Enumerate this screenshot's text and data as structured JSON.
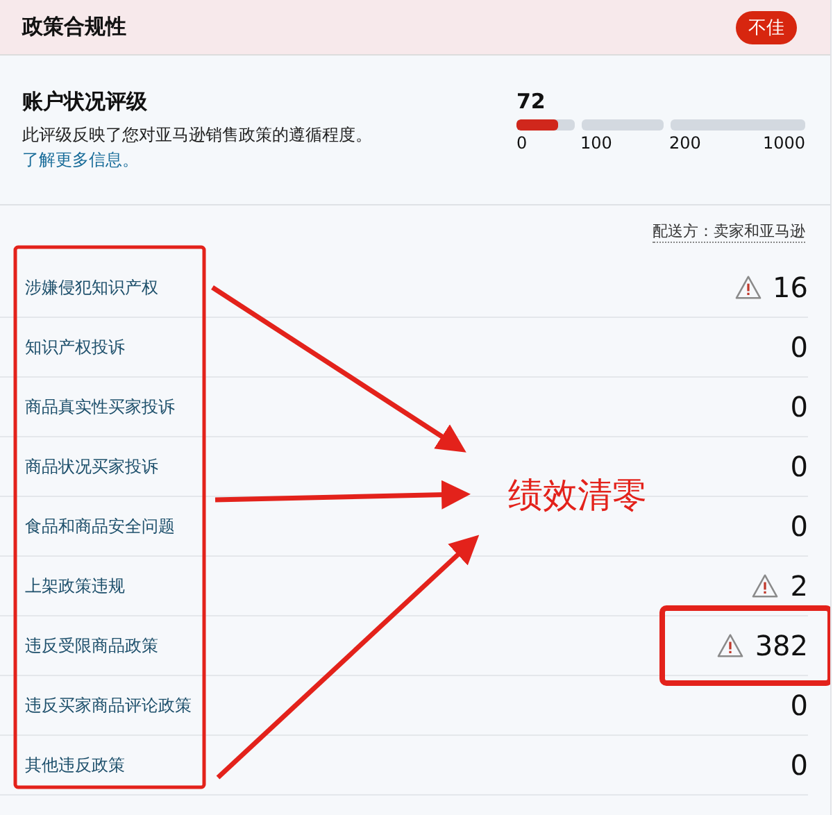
{
  "header": {
    "title": "政策合规性",
    "badge": "不佳"
  },
  "rating": {
    "title": "账户状况评级",
    "description": "此评级反映了您对亚马逊销售政策的遵循程度。",
    "link": "了解更多信息。",
    "score": "72",
    "level": 0.72,
    "ticks": [
      "0",
      "100",
      "200",
      "1000"
    ]
  },
  "fulfilled_by": "配送方：卖家和亚马逊",
  "rows": [
    {
      "label": "涉嫌侵犯知识产权",
      "value": "16",
      "warning": true
    },
    {
      "label": "知识产权投诉",
      "value": "0",
      "warning": false
    },
    {
      "label": "商品真实性买家投诉",
      "value": "0",
      "warning": false
    },
    {
      "label": "商品状况买家投诉",
      "value": "0",
      "warning": false
    },
    {
      "label": "食品和商品安全问题",
      "value": "0",
      "warning": false
    },
    {
      "label": "上架政策违规",
      "value": "2",
      "warning": true
    },
    {
      "label": "违反受限商品政策",
      "value": "382",
      "warning": true
    },
    {
      "label": "违反买家商品评论政策",
      "value": "0",
      "warning": false
    },
    {
      "label": "其他违反政策",
      "value": "0",
      "warning": false
    }
  ],
  "annotation": {
    "label": "绩效清零"
  }
}
